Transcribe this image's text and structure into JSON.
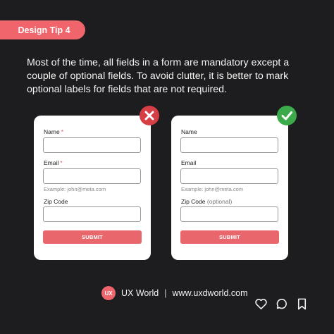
{
  "tip": {
    "label": "Design Tip 4"
  },
  "intro": {
    "text": "Most of the time, all fields in a form are mandatory except a couple of optional fields. To avoid clutter, it is better to mark optional labels for fields that are not required."
  },
  "colors": {
    "accent": "#f0646b",
    "background": "#1d1d1f",
    "wrong": "#d63e45",
    "right": "#3caa4a"
  },
  "bad_form": {
    "status_icon": "cross-icon",
    "name_label": "Name",
    "name_marker": "*",
    "email_label": "Email",
    "email_marker": "*",
    "email_hint": "Example: john@meta.com",
    "zip_label": "Zip Code",
    "submit_label": "SUBMIT"
  },
  "good_form": {
    "status_icon": "check-icon",
    "name_label": "Name",
    "email_label": "Email",
    "email_hint": "Example: john@meta.com",
    "zip_label": "Zip Code",
    "zip_optional": "(optional)",
    "submit_label": "SUBMIT"
  },
  "footer": {
    "logo_text": "UX",
    "brand": "UX World",
    "separator": "|",
    "website": "www.uxdworld.com"
  },
  "actions": [
    "heart-icon",
    "comment-icon",
    "bookmark-icon"
  ]
}
